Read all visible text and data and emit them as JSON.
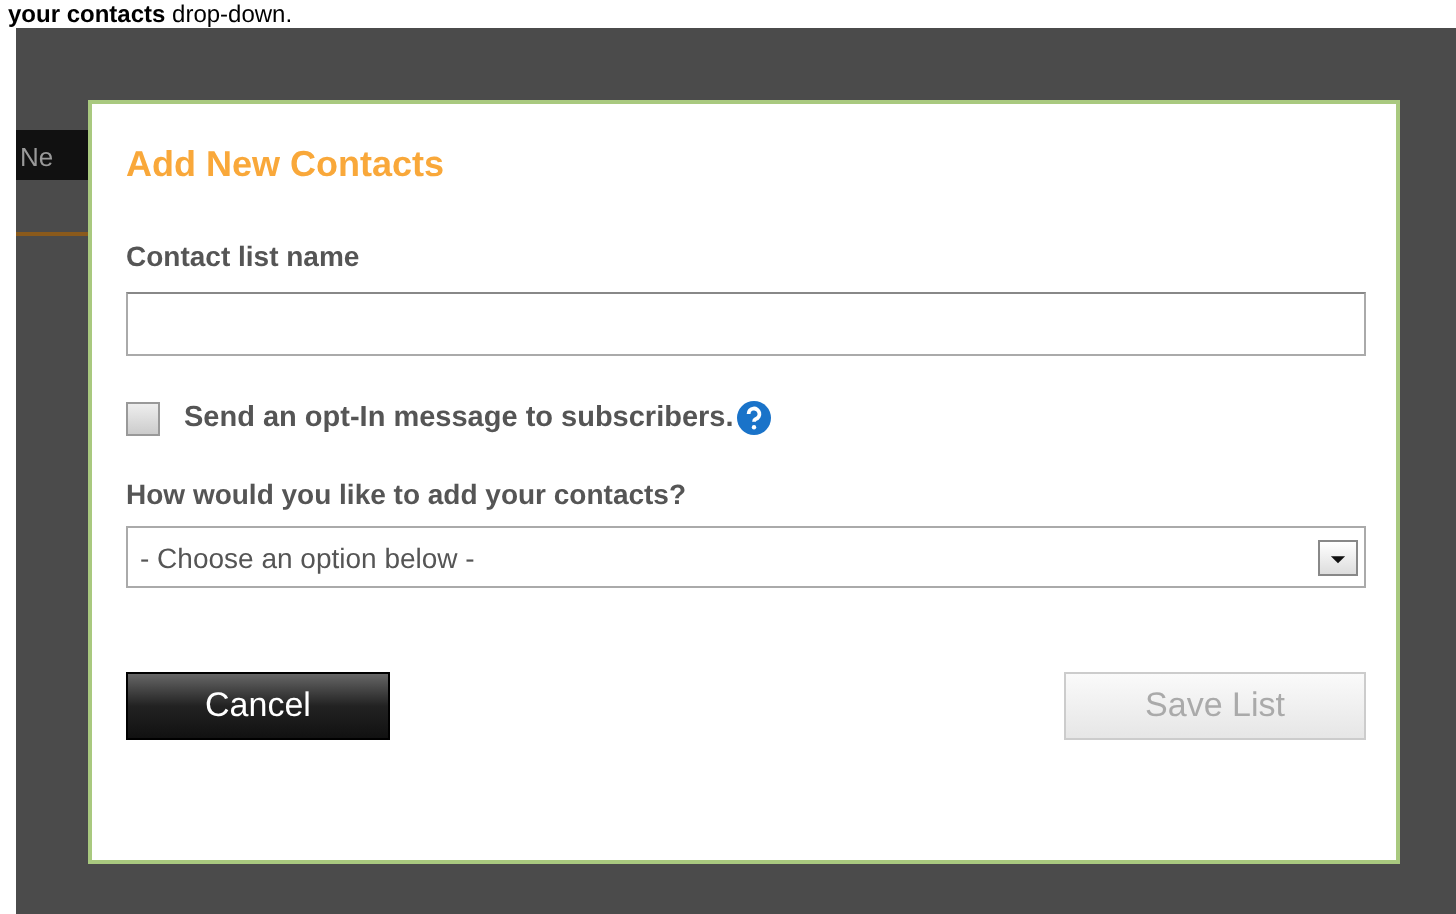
{
  "page_text": "**your contacts** drop-down.",
  "background": {
    "button": "Ne"
  },
  "dialog": {
    "title": "Add New Contacts",
    "name_field": {
      "label": "Contact list name"
    },
    "opt_in": {
      "label": "Send an opt-In message to subscribers.",
      "checked": false
    },
    "method": {
      "label": "How would you like to add your contacts?",
      "value": "- Choose an option below -"
    },
    "buttons": [
      {
        "label": "Cancel",
        "kind": "secondary",
        "disabled": false
      },
      {
        "label": "Save List",
        "kind": "primary",
        "disabled": true
      }
    ]
  }
}
